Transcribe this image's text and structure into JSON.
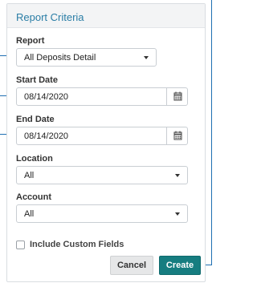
{
  "panel": {
    "title": "Report Criteria"
  },
  "report": {
    "label": "Report",
    "value": "All Deposits Detail"
  },
  "start_date": {
    "label": "Start Date",
    "value": "08/14/2020"
  },
  "end_date": {
    "label": "End Date",
    "value": "08/14/2020"
  },
  "location": {
    "label": "Location",
    "value": "All"
  },
  "account": {
    "label": "Account",
    "value": "All"
  },
  "custom_fields": {
    "label": "Include Custom Fields",
    "checked": false
  },
  "buttons": {
    "cancel": "Cancel",
    "create": "Create"
  },
  "colors": {
    "accent": "#167d80",
    "title": "#2b7ea6",
    "callout": "#1f6fb2"
  },
  "icons": [
    "chevron-down-icon",
    "calendar-icon"
  ]
}
